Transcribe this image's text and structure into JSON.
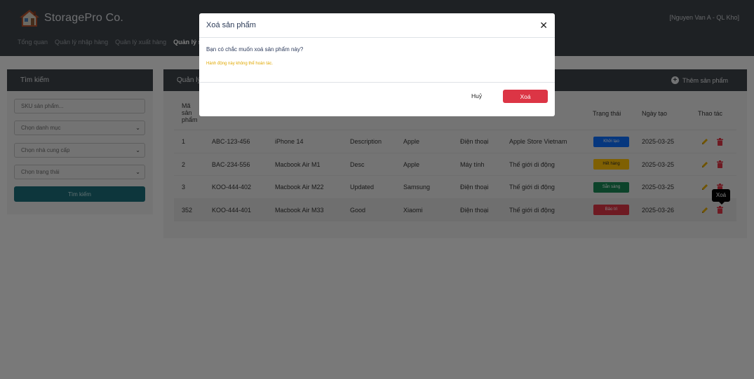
{
  "app": {
    "brand": "StoragePro Co.",
    "user": "[Nguyen Van A - QL Kho]"
  },
  "nav": [
    {
      "label": "Tổng quan"
    },
    {
      "label": "Quản lý nhập hàng"
    },
    {
      "label": "Quản lý xuất hàng"
    },
    {
      "label": "Quản lý sả"
    }
  ],
  "search": {
    "title": "Tìm kiếm",
    "sku_placeholder": "SKU sản phẩm...",
    "category": "Chọn danh mục",
    "supplier": "Chọn nhà cung cấp",
    "status": "Chọn trạng thái",
    "button": "Tìm kiếm"
  },
  "products": {
    "title": "Quản lý",
    "add_button": "Thêm sản phẩm",
    "col_id_lines": [
      "Mã",
      "sản",
      "phẩm"
    ],
    "col_status": "Trạng thái",
    "col_date": "Ngày tạo",
    "col_actions": "Thao tác",
    "rows": [
      {
        "id": "1",
        "sku": "ABC-123-456",
        "name": "iPhone 14",
        "desc": "Description",
        "brand": "Apple",
        "category": "Điện thoại",
        "supplier": "Apple Store Vietnam",
        "status": "Khởi tạo",
        "date": "2025-03-25"
      },
      {
        "id": "2",
        "sku": "BAC-234-556",
        "name": "Macbook Air M1",
        "desc": "Desc",
        "brand": "Apple",
        "category": "Máy tính",
        "supplier": "Thế giới di động",
        "status": "Hết hàng",
        "date": "2025-03-25"
      },
      {
        "id": "3",
        "sku": "KOO-444-402",
        "name": "Macbook Air M22",
        "desc": "Updated",
        "brand": "Samsung",
        "category": "Điện thoại",
        "supplier": "Thế giới di động",
        "status": "Sẵn sàng",
        "date": "2025-03-25"
      },
      {
        "id": "352",
        "sku": "KOO-444-401",
        "name": "Macbook Air M33",
        "desc": "Good",
        "brand": "Xiaomi",
        "category": "Điện thoại",
        "supplier": "Thế giới di động",
        "status": "Bảo trì",
        "date": "2025-03-26"
      }
    ]
  },
  "status_colors": {
    "Khởi tạo": {
      "bg": "#0d6efd",
      "fg": "#ffffff"
    },
    "Hết hàng": {
      "bg": "#ffc107",
      "fg": "#212529"
    },
    "Sẵn sàng": {
      "bg": "#198754",
      "fg": "#ffffff"
    },
    "Bảo trì": {
      "bg": "#dc3545",
      "fg": "#ffffff"
    }
  },
  "tooltip": "Xoá",
  "modal": {
    "title": "Xoá sản phẩm",
    "question": "Bạn có chắc muốn xoá sản phẩm này?",
    "warning": "Hành động này không thể hoàn tác.",
    "cancel": "Huỷ",
    "confirm": "Xoá",
    "close_icon": "close-icon"
  }
}
